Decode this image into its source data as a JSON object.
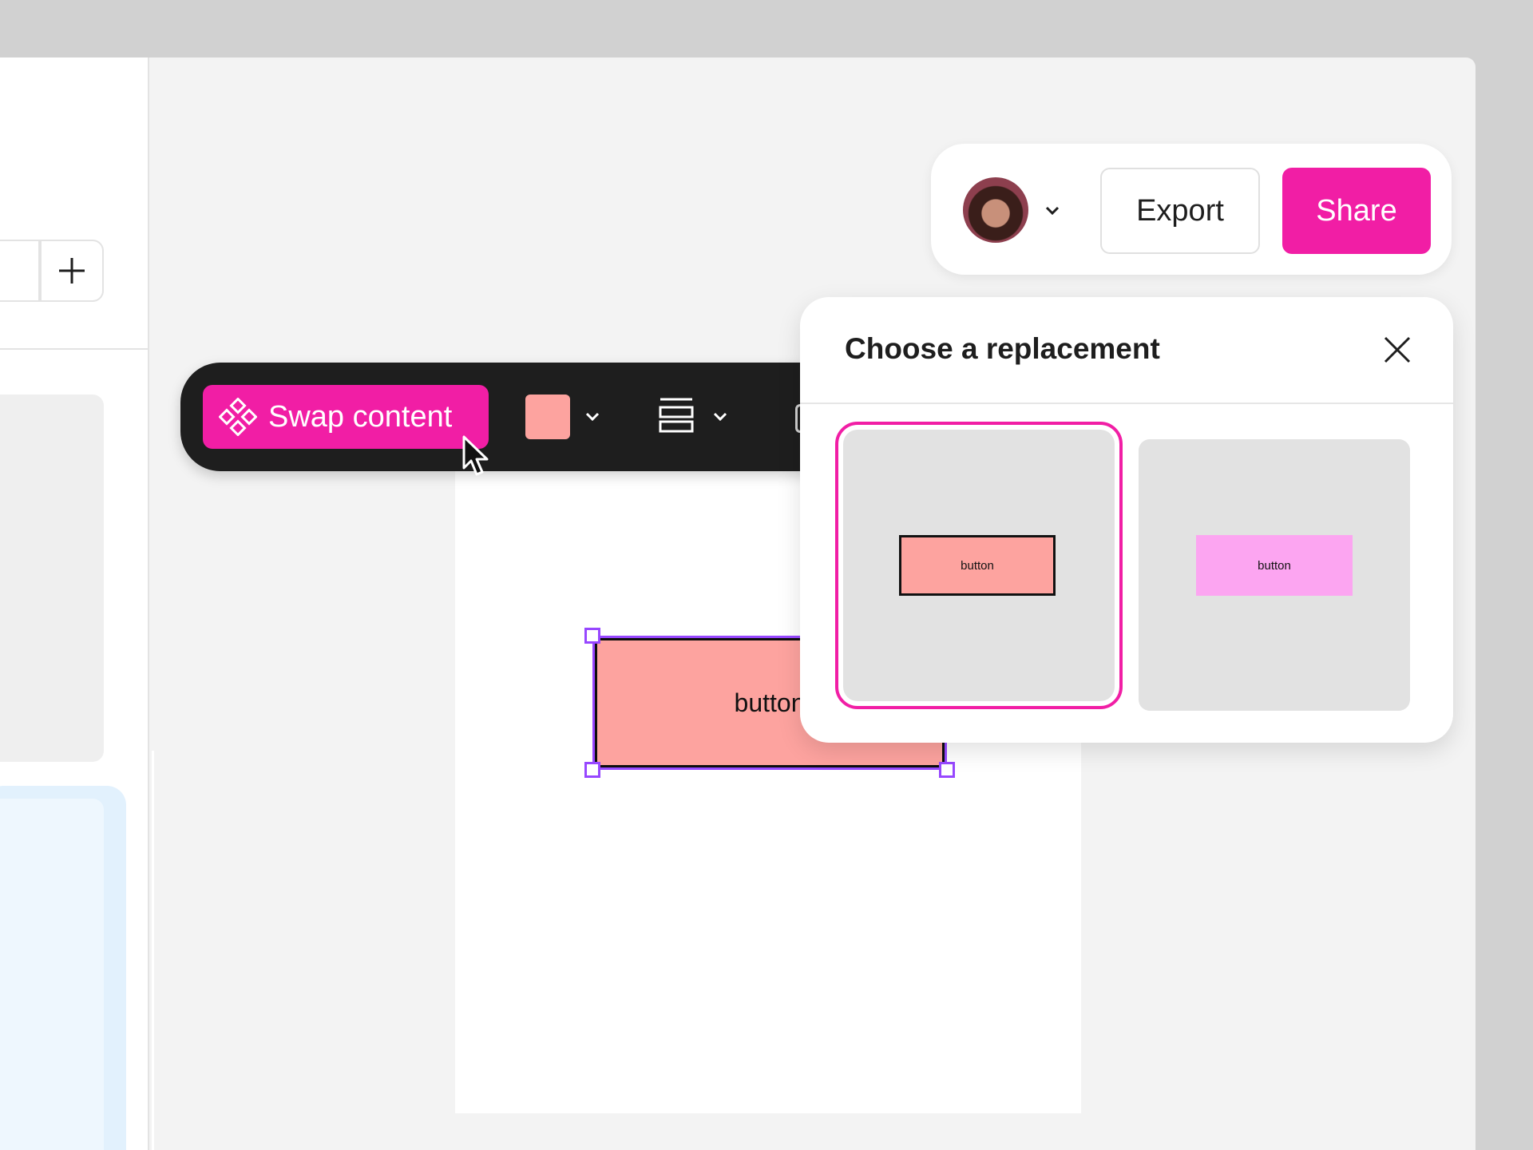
{
  "toolbar": {
    "swap_label": "Swap content",
    "fill_color": "#fda39f",
    "icons": [
      "component-icon",
      "chevron-down-icon",
      "layout-rows-icon",
      "chevron-down-icon"
    ]
  },
  "canvas": {
    "button_label": "button"
  },
  "share_bar": {
    "avatar_icon": "user-avatar",
    "export_label": "Export",
    "share_label": "Share"
  },
  "popover": {
    "title": "Choose a replacement",
    "close_icon": "close-icon",
    "options": [
      {
        "label": "button",
        "fill": "#fda39f",
        "stroke": "#111111",
        "selected": true
      },
      {
        "label": "button",
        "fill": "#fca5f1",
        "stroke": "none",
        "selected": false
      }
    ]
  },
  "colors": {
    "accent": "#f11ea5",
    "selection": "#9747ff",
    "toolbar_bg": "#1e1e1e"
  }
}
